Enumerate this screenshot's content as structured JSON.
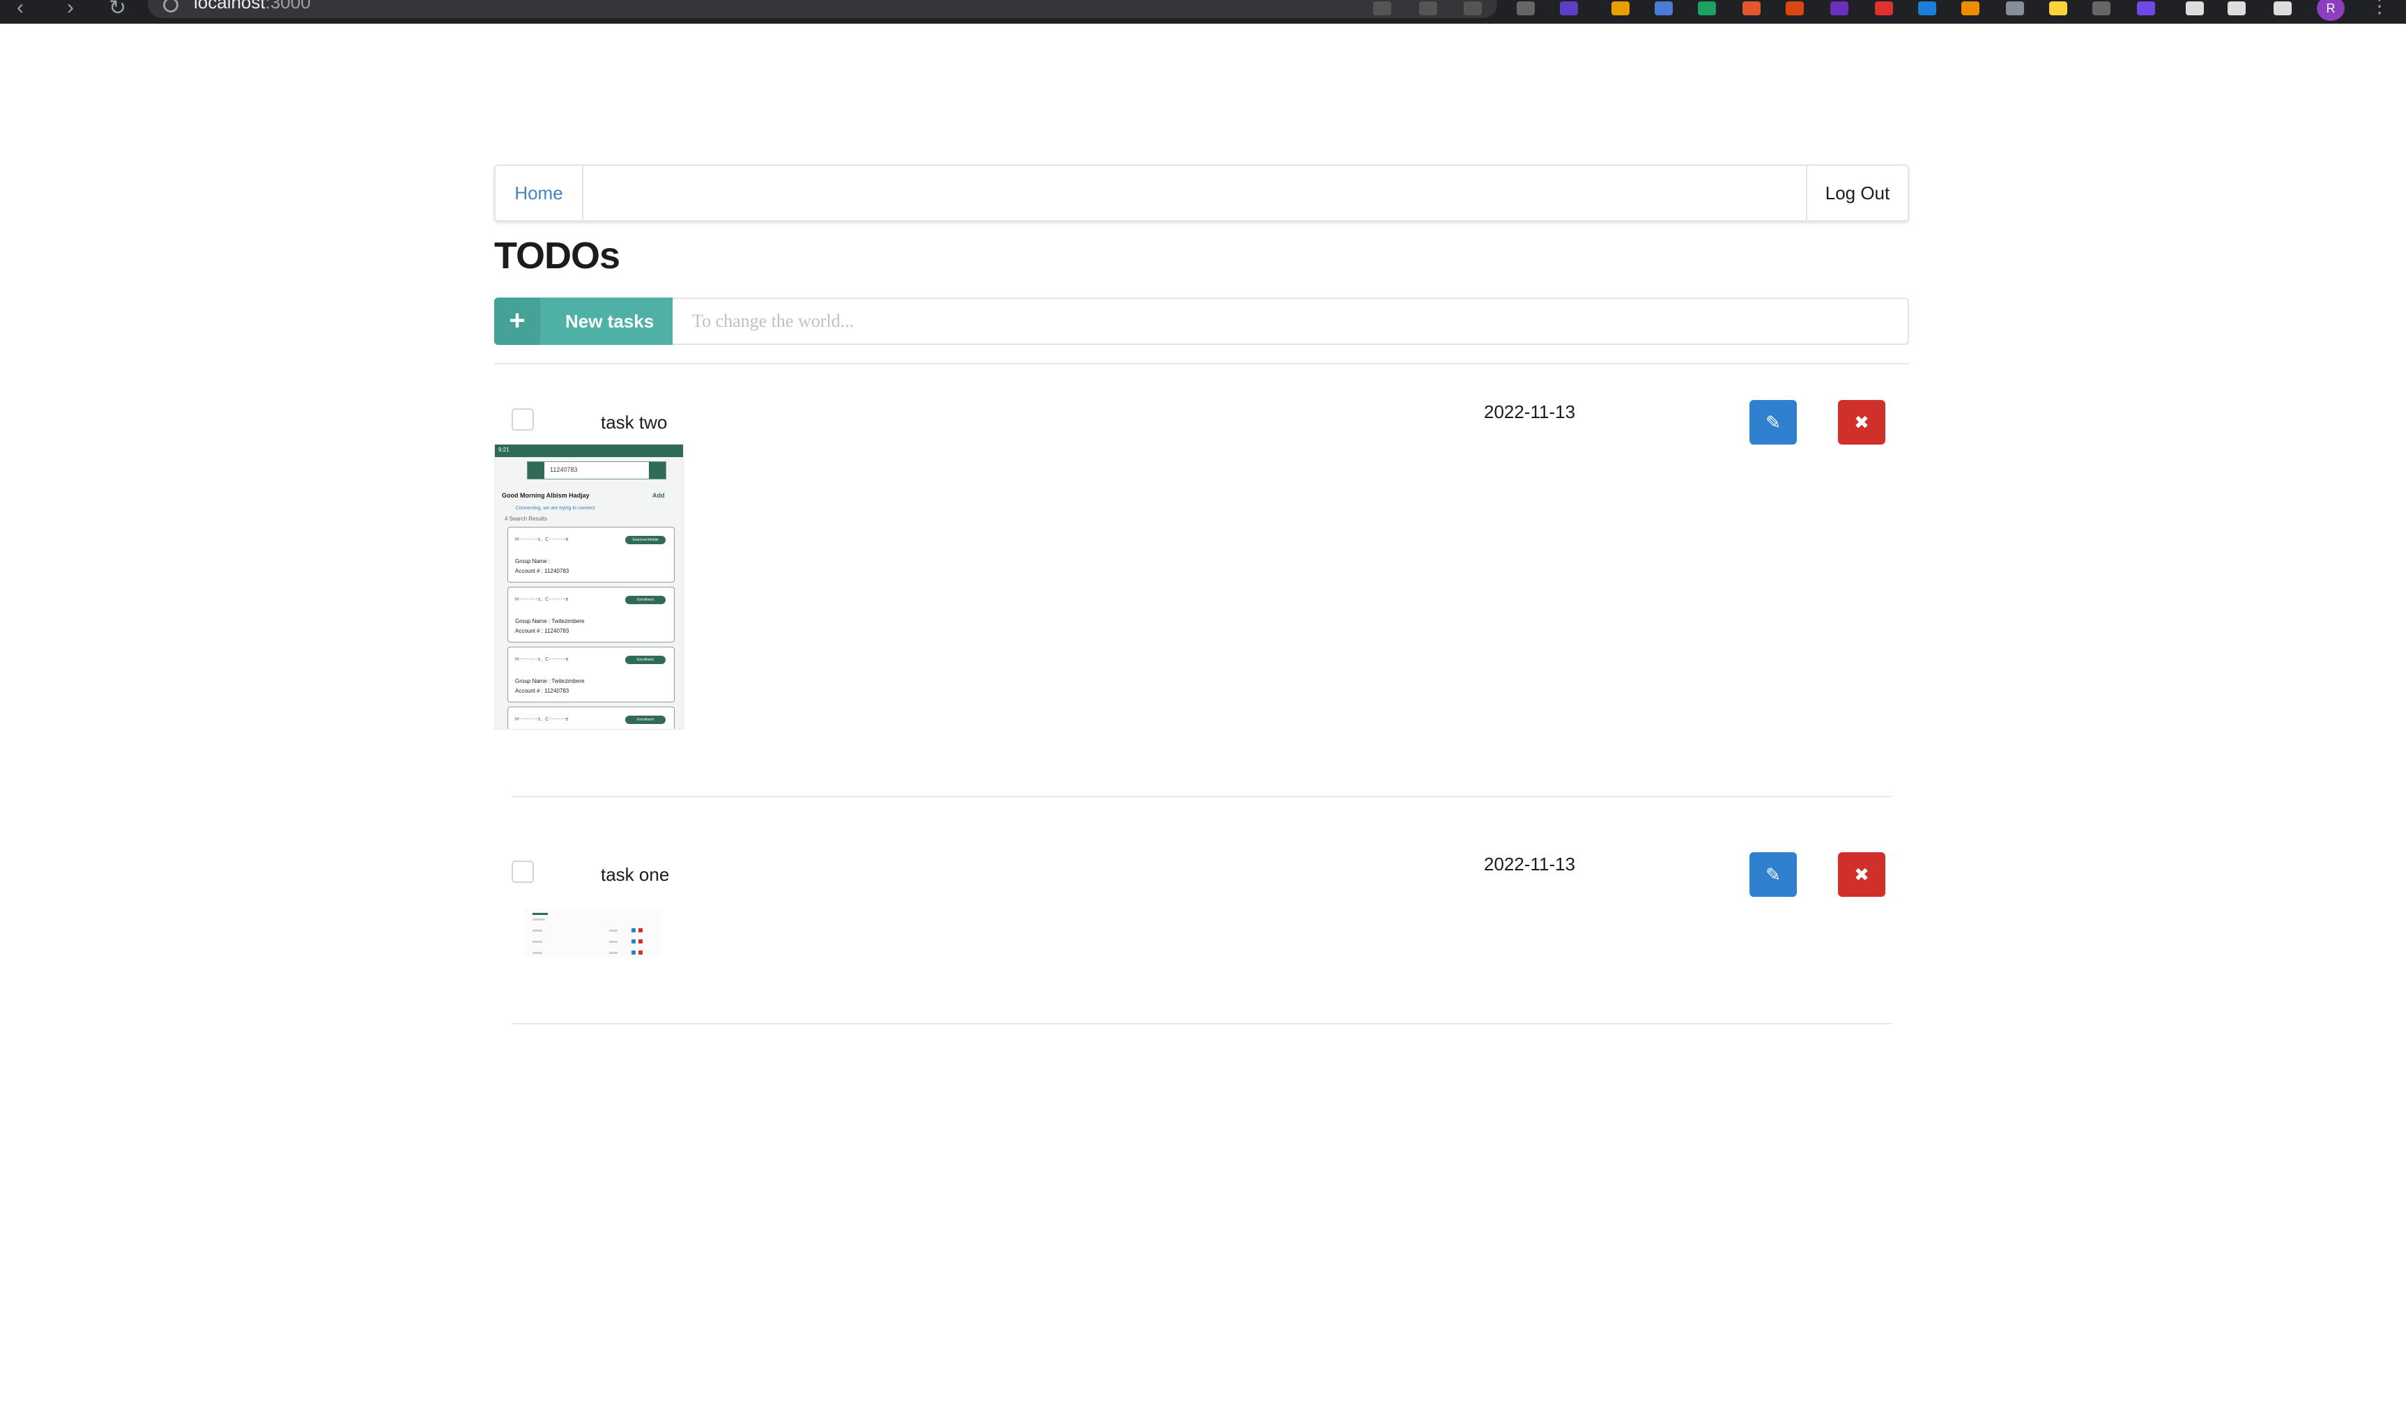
{
  "browser": {
    "url_host": "localhost",
    "url_port": ":3000"
  },
  "menu": {
    "home_label": "Home",
    "logout_label": "Log Out"
  },
  "page": {
    "title": "TODOs"
  },
  "new_task": {
    "button_label": "New tasks",
    "icon": "plus-icon",
    "placeholder": "To change the world..."
  },
  "tasks": [
    {
      "name": "task two",
      "date": "2022-11-13",
      "thumbnail": {
        "status_time": "9:21",
        "search_query": "11240783",
        "greeting": "Good Morning Albism Hadjay",
        "add_label": "Add",
        "connecting": "Connecting, we are trying to connect",
        "results": "4 Search Results",
        "cards": [
          {
            "name": "H--------s, C-------e",
            "badge": "Searched Mobile",
            "group": "Group Name :",
            "account": "Account # : 11240783"
          },
          {
            "name": "H--------s, C-------e",
            "badge": "Enrollment",
            "group": "Group Name : Twitezimbere",
            "account": "Account # : 11240783"
          },
          {
            "name": "H--------s, C-------e",
            "badge": "Enrollment",
            "group": "Group Name : Twitezimbere",
            "account": "Account # : 11240783"
          },
          {
            "name": "H--------s, C-------e",
            "badge": "Enrollment",
            "group": "",
            "account": ""
          }
        ]
      }
    },
    {
      "name": "task one",
      "date": "2022-11-13"
    }
  ],
  "colors": {
    "primary_teal": "#4fb0a6",
    "edit_blue": "#2f80ce",
    "delete_red": "#d0302a",
    "link_blue": "#4183c4"
  },
  "icons": {
    "edit": "pencil-icon",
    "delete": "close-icon"
  }
}
